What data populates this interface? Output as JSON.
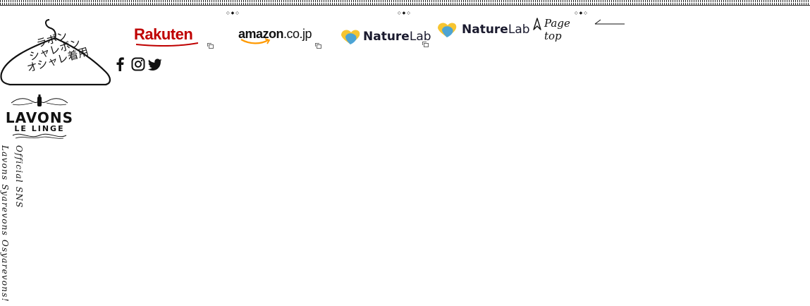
{
  "hanger_logo": {
    "lines": [
      "ラボン",
      "シャレボン",
      "オシャレ着用"
    ]
  },
  "brand": {
    "name": "LAVONS",
    "sub": "LE LINGE"
  },
  "vertical": {
    "tagline": "Lavons  Syarevons  Osyarevons!",
    "sns": "Official SNS"
  },
  "shops": [
    {
      "name": "Rakuten",
      "icon": "external-link-icon"
    },
    {
      "name": "amazon",
      "suffix": ".co.jp",
      "icon": "external-link-icon"
    },
    {
      "name_bold": "Nature",
      "name_light": "Lab",
      "icon": "external-link-icon"
    }
  ],
  "naturelab_logo": {
    "bold": "Nature",
    "light": "Lab"
  },
  "decor": {
    "diamonds": "◇◆◇"
  },
  "page_top": {
    "label": "Page top"
  },
  "social": [
    {
      "name": "facebook-icon"
    },
    {
      "name": "instagram-icon"
    },
    {
      "name": "twitter-icon"
    }
  ],
  "colors": {
    "rakuten": "#bf0000",
    "amazon_smile": "#ff9900",
    "naturelab_yellow": "#f7c531",
    "naturelab_blue": "#3aa0e6",
    "text": "#111111"
  }
}
